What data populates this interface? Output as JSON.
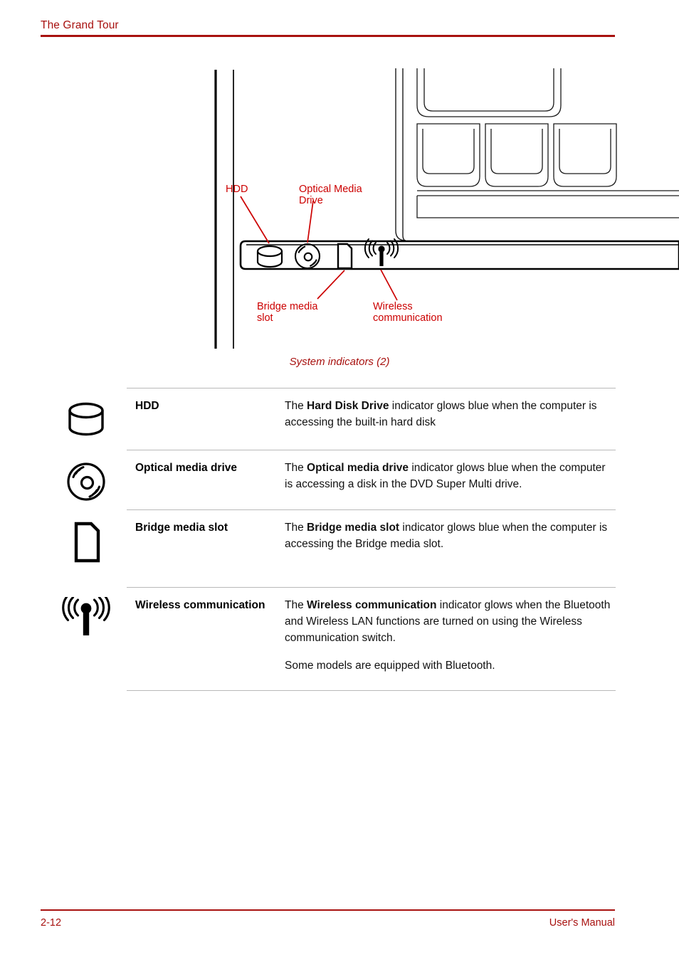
{
  "header": {
    "title": "The Grand Tour",
    "rule_color": "#A8110F"
  },
  "figure": {
    "caption": "System indicators (2)",
    "callouts": {
      "hdd": "HDD",
      "optical_line1": "Optical Media",
      "optical_line2": "Drive",
      "bridge_line1": "Bridge media",
      "bridge_line2": "slot",
      "wireless_line1": "Wireless",
      "wireless_line2": "communication"
    },
    "indicator_icons": [
      "hdd-icon",
      "optical-disc-icon",
      "media-card-icon",
      "wireless-antenna-icon"
    ],
    "callout_color": "#CC0000"
  },
  "table": {
    "rows": [
      {
        "icon": "hdd-icon",
        "name": "HDD",
        "desc_pre": "The ",
        "desc_bold": "Hard Disk Drive",
        "desc_post": " indicator glows blue when the computer is accessing the built-in hard disk"
      },
      {
        "icon": "optical-disc-icon",
        "name": "Optical media drive",
        "desc_pre": "The ",
        "desc_bold": "Optical media drive",
        "desc_post": " indicator glows blue when the computer is accessing a disk in the DVD Super Multi drive."
      },
      {
        "icon": "media-card-icon",
        "name": "Bridge media slot",
        "desc_pre": "The ",
        "desc_bold": "Bridge media slot",
        "desc_post": " indicator glows blue when the computer is accessing the Bridge media slot."
      },
      {
        "icon": "wireless-antenna-icon",
        "name": "Wireless communication",
        "desc_pre": "The ",
        "desc_bold": "Wireless communication",
        "desc_post": " indicator glows when the Bluetooth and Wireless LAN functions are turned on using the Wireless communication switch.",
        "desc_second": "Some models are equipped with Bluetooth."
      }
    ]
  },
  "footer": {
    "page_number": "2-12",
    "manual_label": "User's Manual",
    "color": "#A8110F"
  }
}
